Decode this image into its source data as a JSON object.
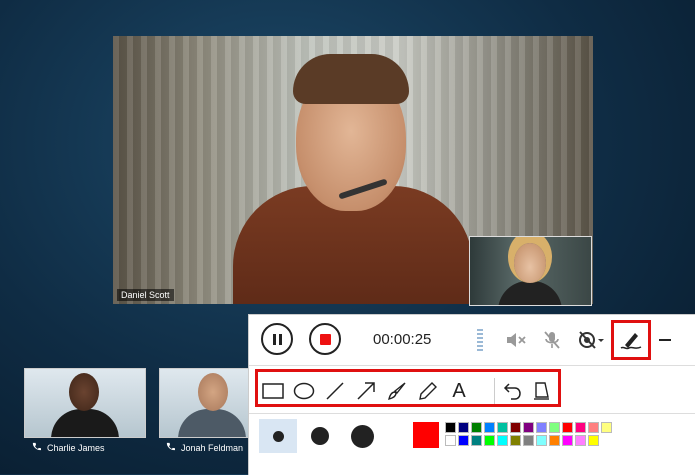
{
  "main_video": {
    "participant_name": "Daniel Scott"
  },
  "thumbnails": [
    {
      "name": "Charlie James"
    },
    {
      "name": "Jonah Feldman"
    }
  ],
  "toolbar": {
    "timer": "00:00:25",
    "icons": {
      "pause": "pause-icon",
      "stop": "stop-record-icon",
      "mute_speaker": "speaker-mute-icon",
      "mute_mic": "mic-off-icon",
      "video_off": "camera-off-icon",
      "annotate": "annotate-pen-icon",
      "minimize": "minimize-icon"
    }
  },
  "drawing_tools": [
    {
      "name": "rectangle-tool",
      "icon": "rectangle-icon"
    },
    {
      "name": "ellipse-tool",
      "icon": "ellipse-icon"
    },
    {
      "name": "line-tool",
      "icon": "line-icon"
    },
    {
      "name": "arrow-tool",
      "icon": "arrow-icon"
    },
    {
      "name": "brush-tool",
      "icon": "brush-icon"
    },
    {
      "name": "pencil-tool",
      "icon": "pencil-icon"
    },
    {
      "name": "text-tool",
      "icon": "text-icon",
      "glyph": "A"
    },
    {
      "name": "undo-tool",
      "icon": "undo-icon"
    },
    {
      "name": "eraser-tool",
      "icon": "eraser-icon"
    }
  ],
  "pen_sizes": [
    "small",
    "medium",
    "large"
  ],
  "selected_pen_size": "small",
  "current_color": "#ff0000",
  "palette": [
    "#000000",
    "#000080",
    "#008000",
    "#0080ff",
    "#00c0a0",
    "#800000",
    "#800080",
    "#8080ff",
    "#80ff80",
    "#ff0000",
    "#ff0080",
    "#ff8080",
    "#ffff80",
    "#ffffff",
    "#0000ff",
    "#008080",
    "#00ff00",
    "#00ffff",
    "#808000",
    "#808080",
    "#80ffff",
    "#ff8000",
    "#ff00ff",
    "#ff80ff",
    "#ffff00"
  ]
}
